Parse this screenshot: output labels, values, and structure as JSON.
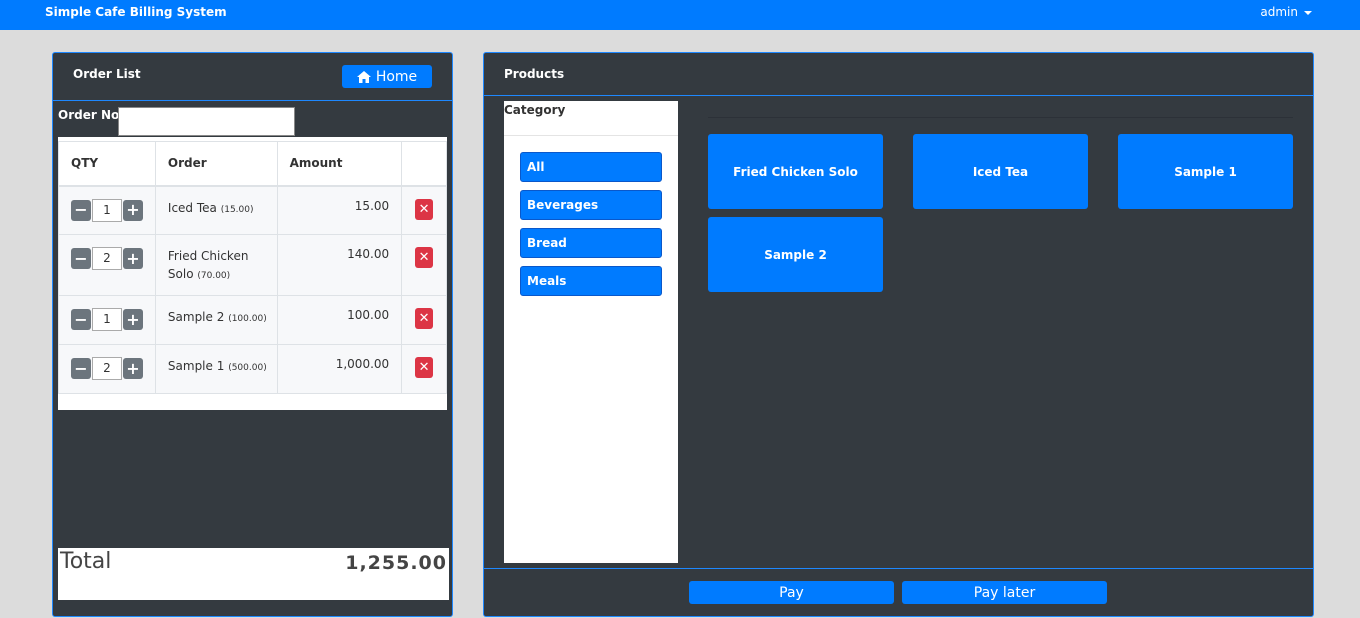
{
  "header": {
    "brand": "Simple Cafe Billing System",
    "user": "admin"
  },
  "order": {
    "title": "Order List",
    "home_label": "Home",
    "order_no_label": "Order No.",
    "order_no_value": "",
    "columns": [
      "QTY",
      "Order",
      "Amount",
      ""
    ],
    "rows": [
      {
        "qty": "1",
        "name": "Iced Tea",
        "price": "(15.00)",
        "amount": "15.00"
      },
      {
        "qty": "2",
        "name": "Fried Chicken Solo",
        "price": "(70.00)",
        "amount": "140.00"
      },
      {
        "qty": "1",
        "name": "Sample 2",
        "price": "(100.00)",
        "amount": "100.00"
      },
      {
        "qty": "2",
        "name": "Sample 1",
        "price": "(500.00)",
        "amount": "1,000.00"
      }
    ],
    "total_label": "Total",
    "total_value": "1,255.00"
  },
  "products": {
    "title": "Products",
    "category_title": "Category",
    "categories": [
      "All",
      "Beverages",
      "Bread",
      "Meals"
    ],
    "items": [
      "Fried Chicken Solo",
      "Iced Tea",
      "Sample 1",
      "Sample 2"
    ],
    "pay_label": "Pay",
    "pay_later_label": "Pay later"
  },
  "colors": {
    "primary": "#007bff",
    "panel": "#343a40",
    "danger": "#dc3545",
    "secondary": "#6c757d"
  },
  "icons": {
    "home": "home-icon",
    "minus": "minus-icon",
    "plus": "plus-icon",
    "remove": "close-icon",
    "dropdown": "caret-down-icon"
  }
}
